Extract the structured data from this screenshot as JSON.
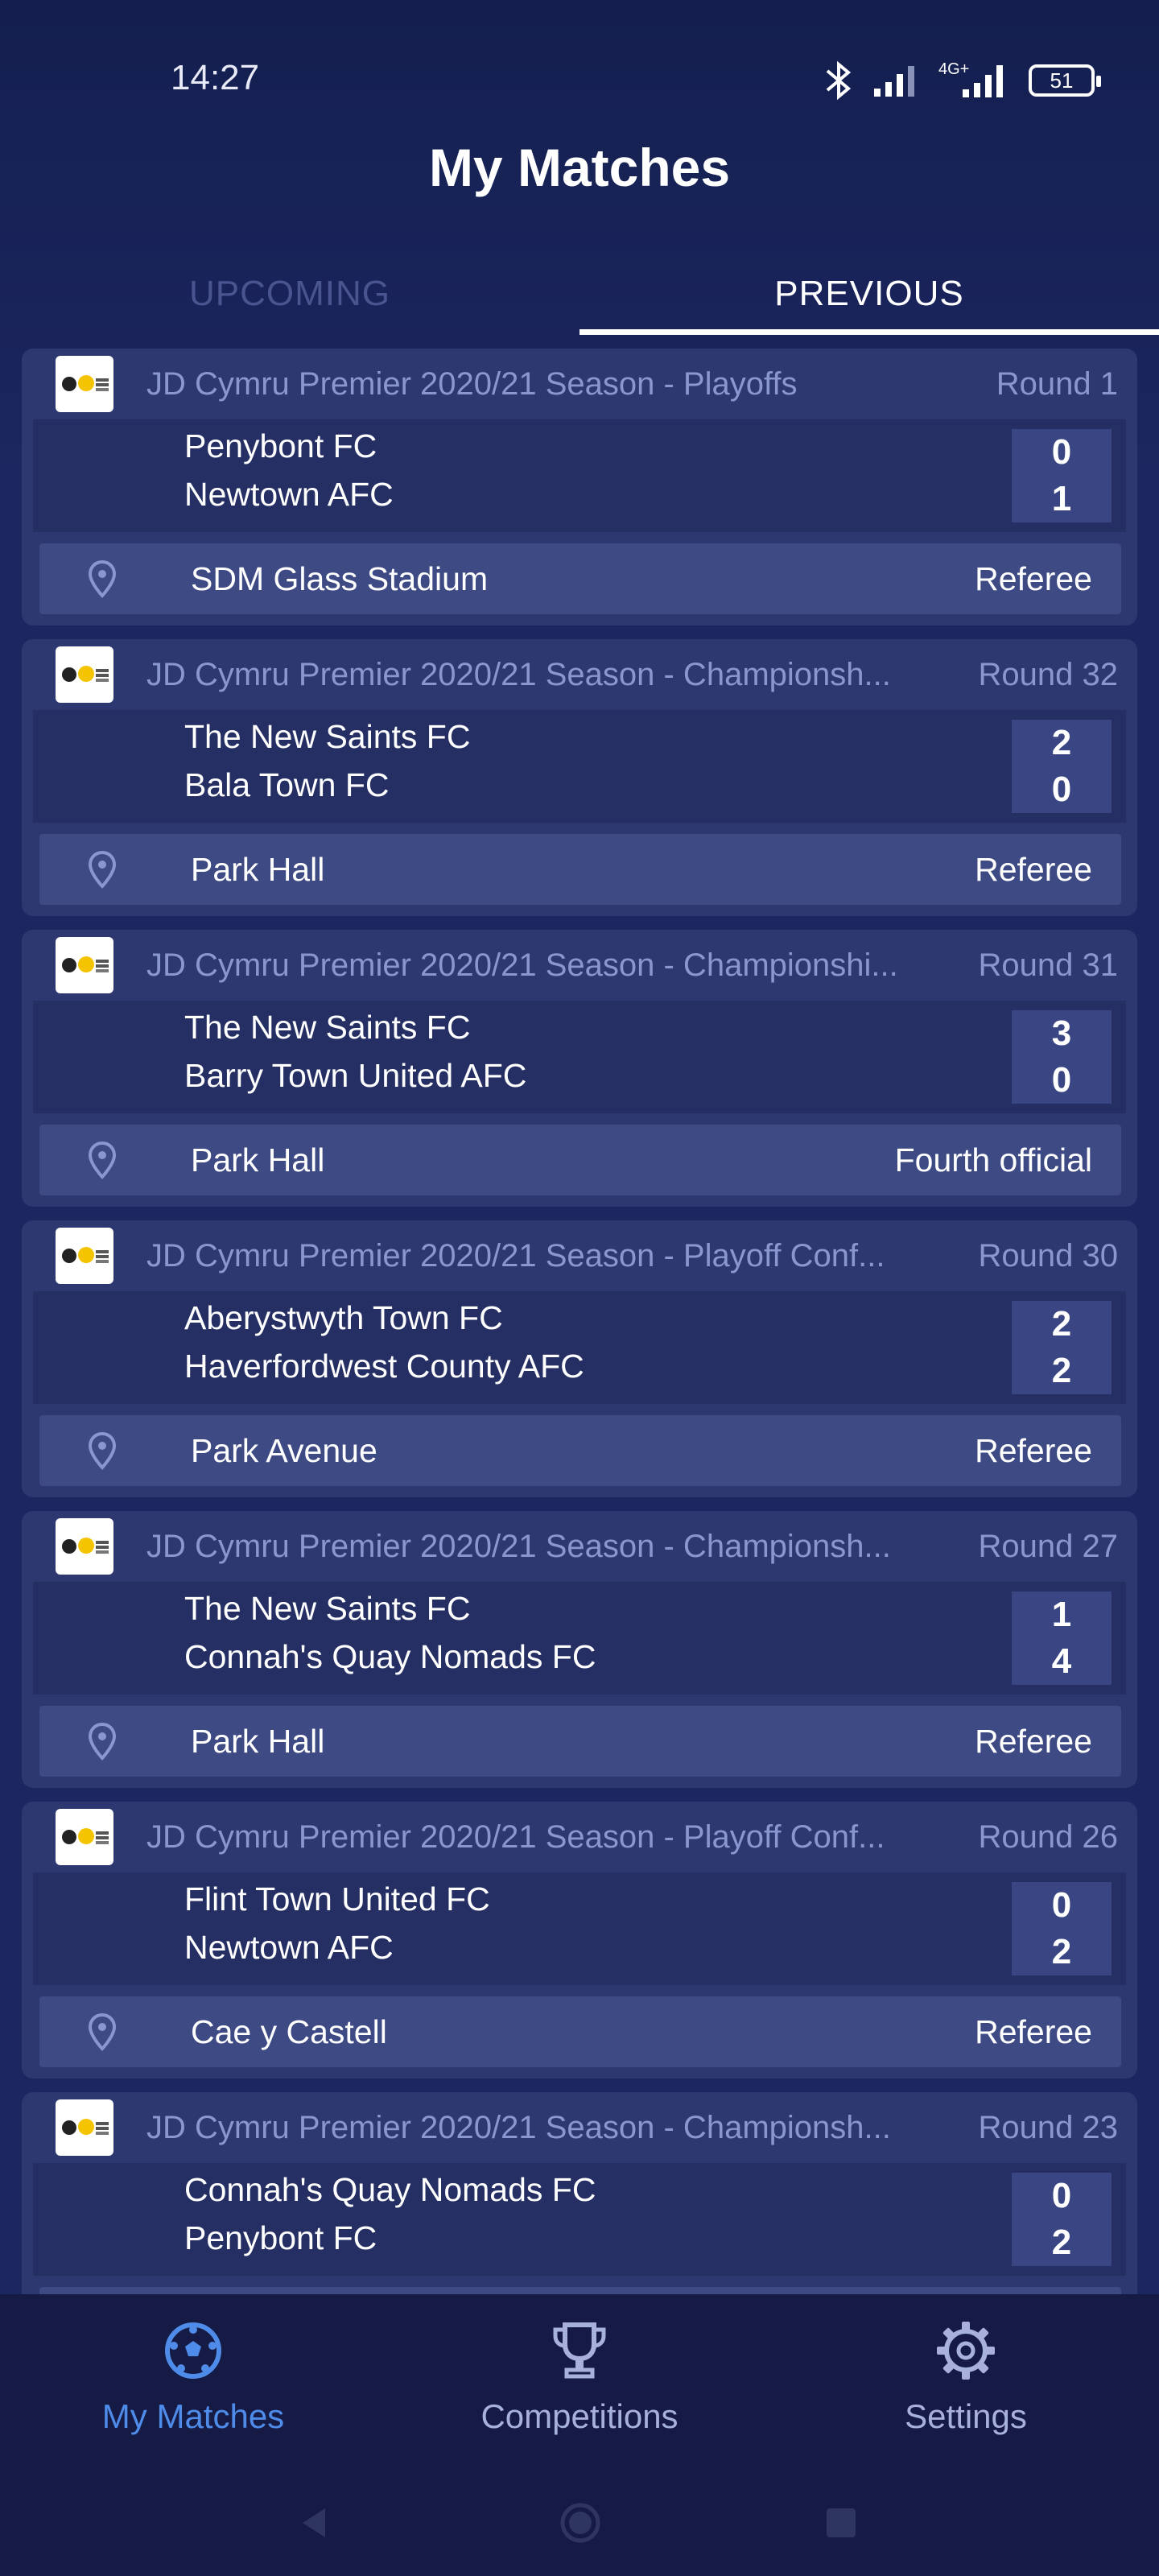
{
  "status_bar": {
    "time": "14:27",
    "network": "4G+",
    "battery": "51",
    "icons": [
      "bluetooth-icon",
      "signal-icon",
      "signal-4g-icon",
      "battery-icon"
    ]
  },
  "header": {
    "title": "My Matches"
  },
  "tabs": [
    {
      "label": "UPCOMING",
      "active": false
    },
    {
      "label": "PREVIOUS",
      "active": true
    }
  ],
  "matches": [
    {
      "competition": "JD Cymru Premier 2020/21 Season - Playoffs",
      "round": "Round 1",
      "home_team": "Penybont FC",
      "away_team": "Newtown AFC",
      "home_score": "0",
      "away_score": "1",
      "venue": "SDM Glass Stadium",
      "role": "Referee"
    },
    {
      "competition": "JD Cymru Premier 2020/21 Season - Championsh...",
      "round": "Round 32",
      "home_team": "The New Saints FC",
      "away_team": "Bala Town FC",
      "home_score": "2",
      "away_score": "0",
      "venue": "Park Hall",
      "role": "Referee"
    },
    {
      "competition": "JD Cymru Premier 2020/21 Season - Championshi...",
      "round": "Round 31",
      "home_team": "The New Saints FC",
      "away_team": "Barry Town United AFC",
      "home_score": "3",
      "away_score": "0",
      "venue": "Park Hall",
      "role": "Fourth official"
    },
    {
      "competition": "JD Cymru Premier 2020/21 Season - Playoff Conf...",
      "round": "Round 30",
      "home_team": "Aberystwyth Town FC",
      "away_team": "Haverfordwest County AFC",
      "home_score": "2",
      "away_score": "2",
      "venue": "Park Avenue",
      "role": "Referee"
    },
    {
      "competition": "JD Cymru Premier 2020/21 Season - Championsh...",
      "round": "Round 27",
      "home_team": "The New Saints FC",
      "away_team": "Connah's Quay Nomads FC",
      "home_score": "1",
      "away_score": "4",
      "venue": "Park Hall",
      "role": "Referee"
    },
    {
      "competition": "JD Cymru Premier 2020/21 Season - Playoff Conf...",
      "round": "Round 26",
      "home_team": "Flint Town United FC",
      "away_team": "Newtown AFC",
      "home_score": "0",
      "away_score": "2",
      "venue": "Cae y Castell",
      "role": "Referee"
    },
    {
      "competition": "JD Cymru Premier 2020/21 Season - Championsh...",
      "round": "Round 23",
      "home_team": "Connah's Quay Nomads FC",
      "away_team": "Penybont FC",
      "home_score": "0",
      "away_score": "2",
      "venue": "",
      "role": ""
    }
  ],
  "bottom_nav": [
    {
      "label": "My Matches",
      "icon": "soccer-ball-icon",
      "active": true
    },
    {
      "label": "Competitions",
      "icon": "trophy-icon",
      "active": false
    },
    {
      "label": "Settings",
      "icon": "gear-icon",
      "active": false
    }
  ],
  "colors": {
    "accent": "#4f8be8",
    "background": "#1c2660",
    "card": "#2d3870"
  }
}
